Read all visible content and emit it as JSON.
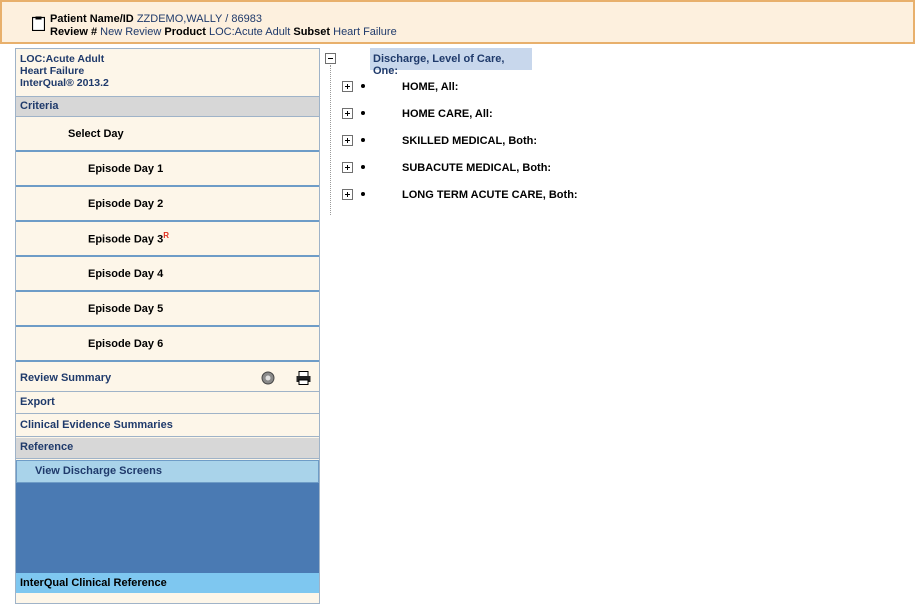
{
  "header": {
    "patient_label": "Patient Name/ID",
    "patient_value": "ZZDEMO,WALLY / 86983",
    "review_label": "Review #",
    "review_value": "New Review",
    "product_label": "Product",
    "product_value": "LOC:Acute Adult",
    "subset_label": "Subset",
    "subset_value": "Heart Failure",
    "icon": "clipboard-icon"
  },
  "sidebar": {
    "loc_line1": "LOC:Acute Adult",
    "loc_line2": "Heart Failure",
    "loc_line3": "InterQual® 2013.2",
    "criteria_label": "Criteria",
    "days": [
      {
        "label": "Select Day",
        "marker": ""
      },
      {
        "label": "Episode Day 1",
        "marker": ""
      },
      {
        "label": "Episode Day 2",
        "marker": ""
      },
      {
        "label": "Episode Day 3",
        "marker": "R"
      },
      {
        "label": "Episode Day 4",
        "marker": ""
      },
      {
        "label": "Episode Day 5",
        "marker": ""
      },
      {
        "label": "Episode Day 6",
        "marker": ""
      }
    ],
    "review_summary": "Review Summary",
    "review_summary_icons": [
      "gear-icon",
      "printer-icon"
    ],
    "export": "Export",
    "clinical_evidence": "Clinical Evidence Summaries",
    "reference": "Reference",
    "view_discharge": "View Discharge Screens",
    "interqual_ref": "InterQual Clinical Reference"
  },
  "tree": {
    "root_label": "Discharge, Level of Care, One:",
    "nodes": [
      {
        "label": "HOME, All:"
      },
      {
        "label": "HOME CARE, All:"
      },
      {
        "label": "SKILLED MEDICAL, Both:"
      },
      {
        "label": "SUBACUTE MEDICAL, Both:"
      },
      {
        "label": "LONG TERM ACUTE CARE, Both:"
      }
    ]
  },
  "colors": {
    "header_bg": "#fdf0de",
    "header_border": "#e8b06c",
    "sidebar_bg": "#fdf6e9",
    "section_gray": "#d7d7d7",
    "text_navy": "#1f3a6b",
    "selected_blue": "#a9d3ea",
    "panel_blue": "#4a7ab3",
    "reference_blue": "#7ec7f0",
    "root_highlight": "#c8d7ec",
    "marker_red": "#e03020"
  }
}
